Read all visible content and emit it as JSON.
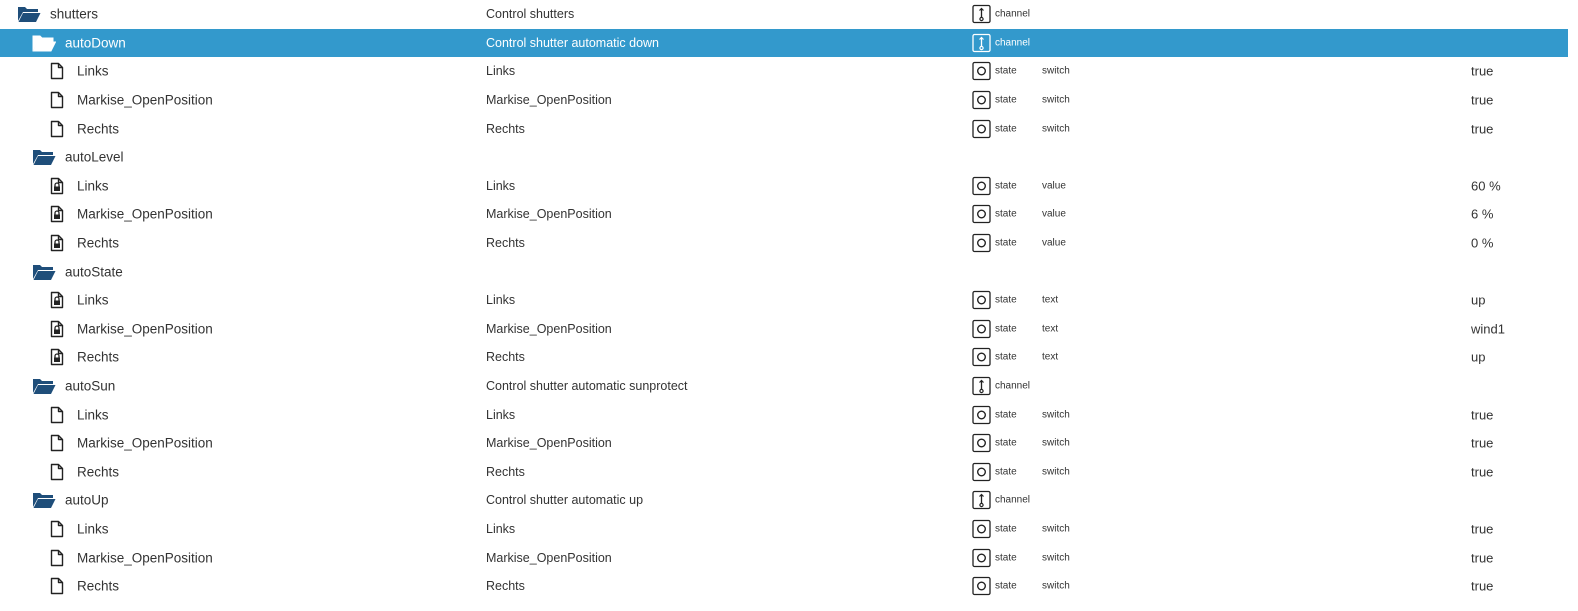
{
  "colors": {
    "selected_bg": "#3399cc",
    "folder": "#1f4e7a",
    "text": "#333333"
  },
  "rows": [
    {
      "kind": "folder",
      "level": 0,
      "name": "shutters",
      "desc": "Control shutters",
      "type": "channel",
      "type_icon": "channel-icon",
      "role": "",
      "value": "",
      "selected": false
    },
    {
      "kind": "folder",
      "level": 1,
      "name": "autoDown",
      "desc": "Control shutter automatic down",
      "type": "channel",
      "type_icon": "channel-icon",
      "role": "",
      "value": "",
      "selected": true
    },
    {
      "kind": "file",
      "level": 2,
      "name": "Links",
      "desc": "Links",
      "type": "state",
      "type_icon": "state-icon",
      "role": "switch",
      "value": "true",
      "selected": false
    },
    {
      "kind": "file",
      "level": 2,
      "name": "Markise_OpenPosition",
      "desc": "Markise_OpenPosition",
      "type": "state",
      "type_icon": "state-icon",
      "role": "switch",
      "value": "true",
      "selected": false
    },
    {
      "kind": "file",
      "level": 2,
      "name": "Rechts",
      "desc": "Rechts",
      "type": "state",
      "type_icon": "state-icon",
      "role": "switch",
      "value": "true",
      "selected": false
    },
    {
      "kind": "folder",
      "level": 1,
      "name": "autoLevel",
      "desc": "",
      "type": "",
      "type_icon": "",
      "role": "",
      "value": "",
      "selected": false
    },
    {
      "kind": "locked",
      "level": 2,
      "name": "Links",
      "desc": "Links",
      "type": "state",
      "type_icon": "state-icon",
      "role": "value",
      "value": "60 %",
      "selected": false
    },
    {
      "kind": "locked",
      "level": 2,
      "name": "Markise_OpenPosition",
      "desc": "Markise_OpenPosition",
      "type": "state",
      "type_icon": "state-icon",
      "role": "value",
      "value": "6 %",
      "selected": false
    },
    {
      "kind": "locked",
      "level": 2,
      "name": "Rechts",
      "desc": "Rechts",
      "type": "state",
      "type_icon": "state-icon",
      "role": "value",
      "value": "0 %",
      "selected": false
    },
    {
      "kind": "folder",
      "level": 1,
      "name": "autoState",
      "desc": "",
      "type": "",
      "type_icon": "",
      "role": "",
      "value": "",
      "selected": false
    },
    {
      "kind": "locked",
      "level": 2,
      "name": "Links",
      "desc": "Links",
      "type": "state",
      "type_icon": "state-icon",
      "role": "text",
      "value": "up",
      "selected": false
    },
    {
      "kind": "locked",
      "level": 2,
      "name": "Markise_OpenPosition",
      "desc": "Markise_OpenPosition",
      "type": "state",
      "type_icon": "state-icon",
      "role": "text",
      "value": "wind1",
      "selected": false
    },
    {
      "kind": "locked",
      "level": 2,
      "name": "Rechts",
      "desc": "Rechts",
      "type": "state",
      "type_icon": "state-icon",
      "role": "text",
      "value": "up",
      "selected": false
    },
    {
      "kind": "folder",
      "level": 1,
      "name": "autoSun",
      "desc": "Control shutter automatic sunprotect",
      "type": "channel",
      "type_icon": "channel-icon",
      "role": "",
      "value": "",
      "selected": false
    },
    {
      "kind": "file",
      "level": 2,
      "name": "Links",
      "desc": "Links",
      "type": "state",
      "type_icon": "state-icon",
      "role": "switch",
      "value": "true",
      "selected": false
    },
    {
      "kind": "file",
      "level": 2,
      "name": "Markise_OpenPosition",
      "desc": "Markise_OpenPosition",
      "type": "state",
      "type_icon": "state-icon",
      "role": "switch",
      "value": "true",
      "selected": false
    },
    {
      "kind": "file",
      "level": 2,
      "name": "Rechts",
      "desc": "Rechts",
      "type": "state",
      "type_icon": "state-icon",
      "role": "switch",
      "value": "true",
      "selected": false
    },
    {
      "kind": "folder",
      "level": 1,
      "name": "autoUp",
      "desc": "Control shutter automatic up",
      "type": "channel",
      "type_icon": "channel-icon",
      "role": "",
      "value": "",
      "selected": false
    },
    {
      "kind": "file",
      "level": 2,
      "name": "Links",
      "desc": "Links",
      "type": "state",
      "type_icon": "state-icon",
      "role": "switch",
      "value": "true",
      "selected": false
    },
    {
      "kind": "file",
      "level": 2,
      "name": "Markise_OpenPosition",
      "desc": "Markise_OpenPosition",
      "type": "state",
      "type_icon": "state-icon",
      "role": "switch",
      "value": "true",
      "selected": false
    },
    {
      "kind": "file",
      "level": 2,
      "name": "Rechts",
      "desc": "Rechts",
      "type": "state",
      "type_icon": "state-icon",
      "role": "switch",
      "value": "true",
      "selected": false
    }
  ]
}
